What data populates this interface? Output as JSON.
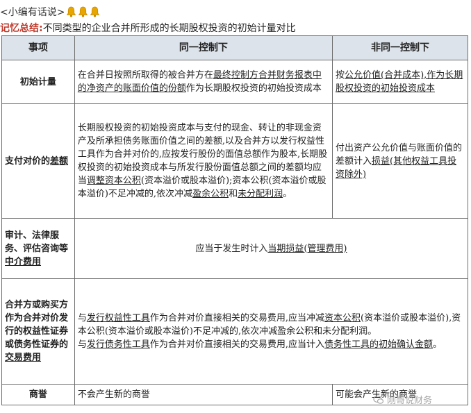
{
  "header": {
    "tag": "<小编有话说>",
    "icons": [
      "bell-icon",
      "bell-icon",
      "bell-icon"
    ],
    "bell_color": "#e8a600"
  },
  "summary": {
    "label": "记忆总结:",
    "text": "不同类型的企业合并所形成的长期股权投资的初始计量对比",
    "label_color": "#c0392b"
  },
  "table": {
    "headers": [
      "事项",
      "同一控制下",
      "非同一控制下"
    ],
    "header_bg": "#dde3ea",
    "rows": {
      "initial": {
        "label": "初始计量",
        "same_pre": "在合并日按照所取得的被合并方在",
        "same_u": "最终控制方合并财务报表中的净资产的账面价值的份额",
        "same_post": "作为长期股权投资的初始投资成本",
        "diff_pre": "按",
        "diff_u": "公允价值(合并成本),作为长期股权投资的初始投资成本",
        "diff_post": ""
      },
      "payment": {
        "label_pre": "支付对价的",
        "label_u": "差额",
        "same_1": "长期股权投资的初始投资成本与支付的现金、转让的非现金资产及所承担债务账面价值之间的差额,以及合并方以发行权益性工具作为合并对价的,应按发行股份的面值总额作为股本,长期股权投资的初始投资成本与所发行股份面值总额之间的差额均应当",
        "same_u1": "调整资本公积",
        "same_2": "(资本溢价或股本溢价);资本公积(资本溢价或股本溢价)不足冲减的,依次冲减",
        "same_u2": "盈余公积",
        "same_3": "和",
        "same_u3": "未分配利润",
        "same_4": "。",
        "diff_pre": "付出资产公允价值与账面价值的差额计入",
        "diff_u": "损益(其他权益工具投资除外)"
      },
      "audit": {
        "label_pre": "审计、法律服务、评估咨询等",
        "label_u": "中介费用",
        "text_pre": "应当于发生时计入",
        "text_u": "当期损益(管理费用)"
      },
      "transaction": {
        "label_pre": "合并方或购买方作为合并对价发行的权益性证券或债务性证券的",
        "label_u": "交易费用",
        "p1_pre": "与",
        "p1_u1": "发行权益性工具",
        "p1_mid": "作为合并对价直接相关的交易费用,应当冲减",
        "p1_u2": "资本公积",
        "p1_post": "(资本溢价或股本溢价),资本公积(资本溢价或股本溢价)不足冲减的,依次冲减盈余公积和未分配利润。",
        "p2_pre": "与",
        "p2_u1": "发行债务性工具",
        "p2_mid": "作为合并对价直接相关的交易费用,应当计入",
        "p2_u2": "债务性工具的初始确认金额",
        "p2_post": "。"
      },
      "goodwill": {
        "label": "商誉",
        "same": "不会产生新的商誉",
        "diff": "可能会产生新的商誉"
      }
    }
  },
  "watermark": {
    "text": "刚哥说财务",
    "icon": "wechat-icon"
  }
}
